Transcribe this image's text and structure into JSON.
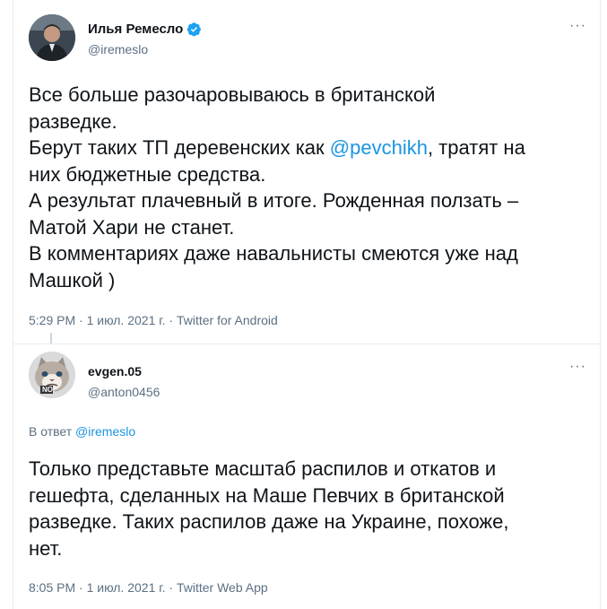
{
  "tweets": [
    {
      "author_name": "Илья Ремесло",
      "handle": "@iremeslo",
      "verified": true,
      "more_label": "···",
      "lines": [
        {
          "text": "Все больше разочаровываюсь в британской"
        },
        {
          "text": "разведке."
        },
        {
          "pre": "Берут таких ТП деревенских как ",
          "mention": "@pevchikh",
          "post": ", тратят на"
        },
        {
          "text": "них бюджетные средства."
        },
        {
          "text": "А результат плачевный в итоге. Рожденная ползать –"
        },
        {
          "text": "Матой Хари не станет."
        },
        {
          "text": "В комментариях даже навальнисты смеются уже над"
        },
        {
          "text": "Машкой )"
        }
      ],
      "meta": "5:29 PM · 1 июл. 2021 г. · Twitter for Android"
    },
    {
      "author_name": "evgen.05",
      "handle": "@anton0456",
      "verified": false,
      "more_label": "···",
      "reply_prefix": "В ответ ",
      "reply_mention": "@iremeslo",
      "avatar_badge": "NO.",
      "lines": [
        {
          "text": "Только представьте масштаб распилов и откатов и"
        },
        {
          "text": "гешефта, сделанных на Маше Певчих в британской"
        },
        {
          "text": "разведке. Таких распилов даже на Украине, похоже,"
        },
        {
          "text": "нет."
        }
      ],
      "meta": "8:05 PM · 1 июл. 2021 г. · Twitter Web App"
    }
  ],
  "colors": {
    "text": "#0f1419",
    "secondary": "#5b7083",
    "link": "#1b95e0",
    "verified": "#1da1f2",
    "divider": "#e6ecf0"
  }
}
